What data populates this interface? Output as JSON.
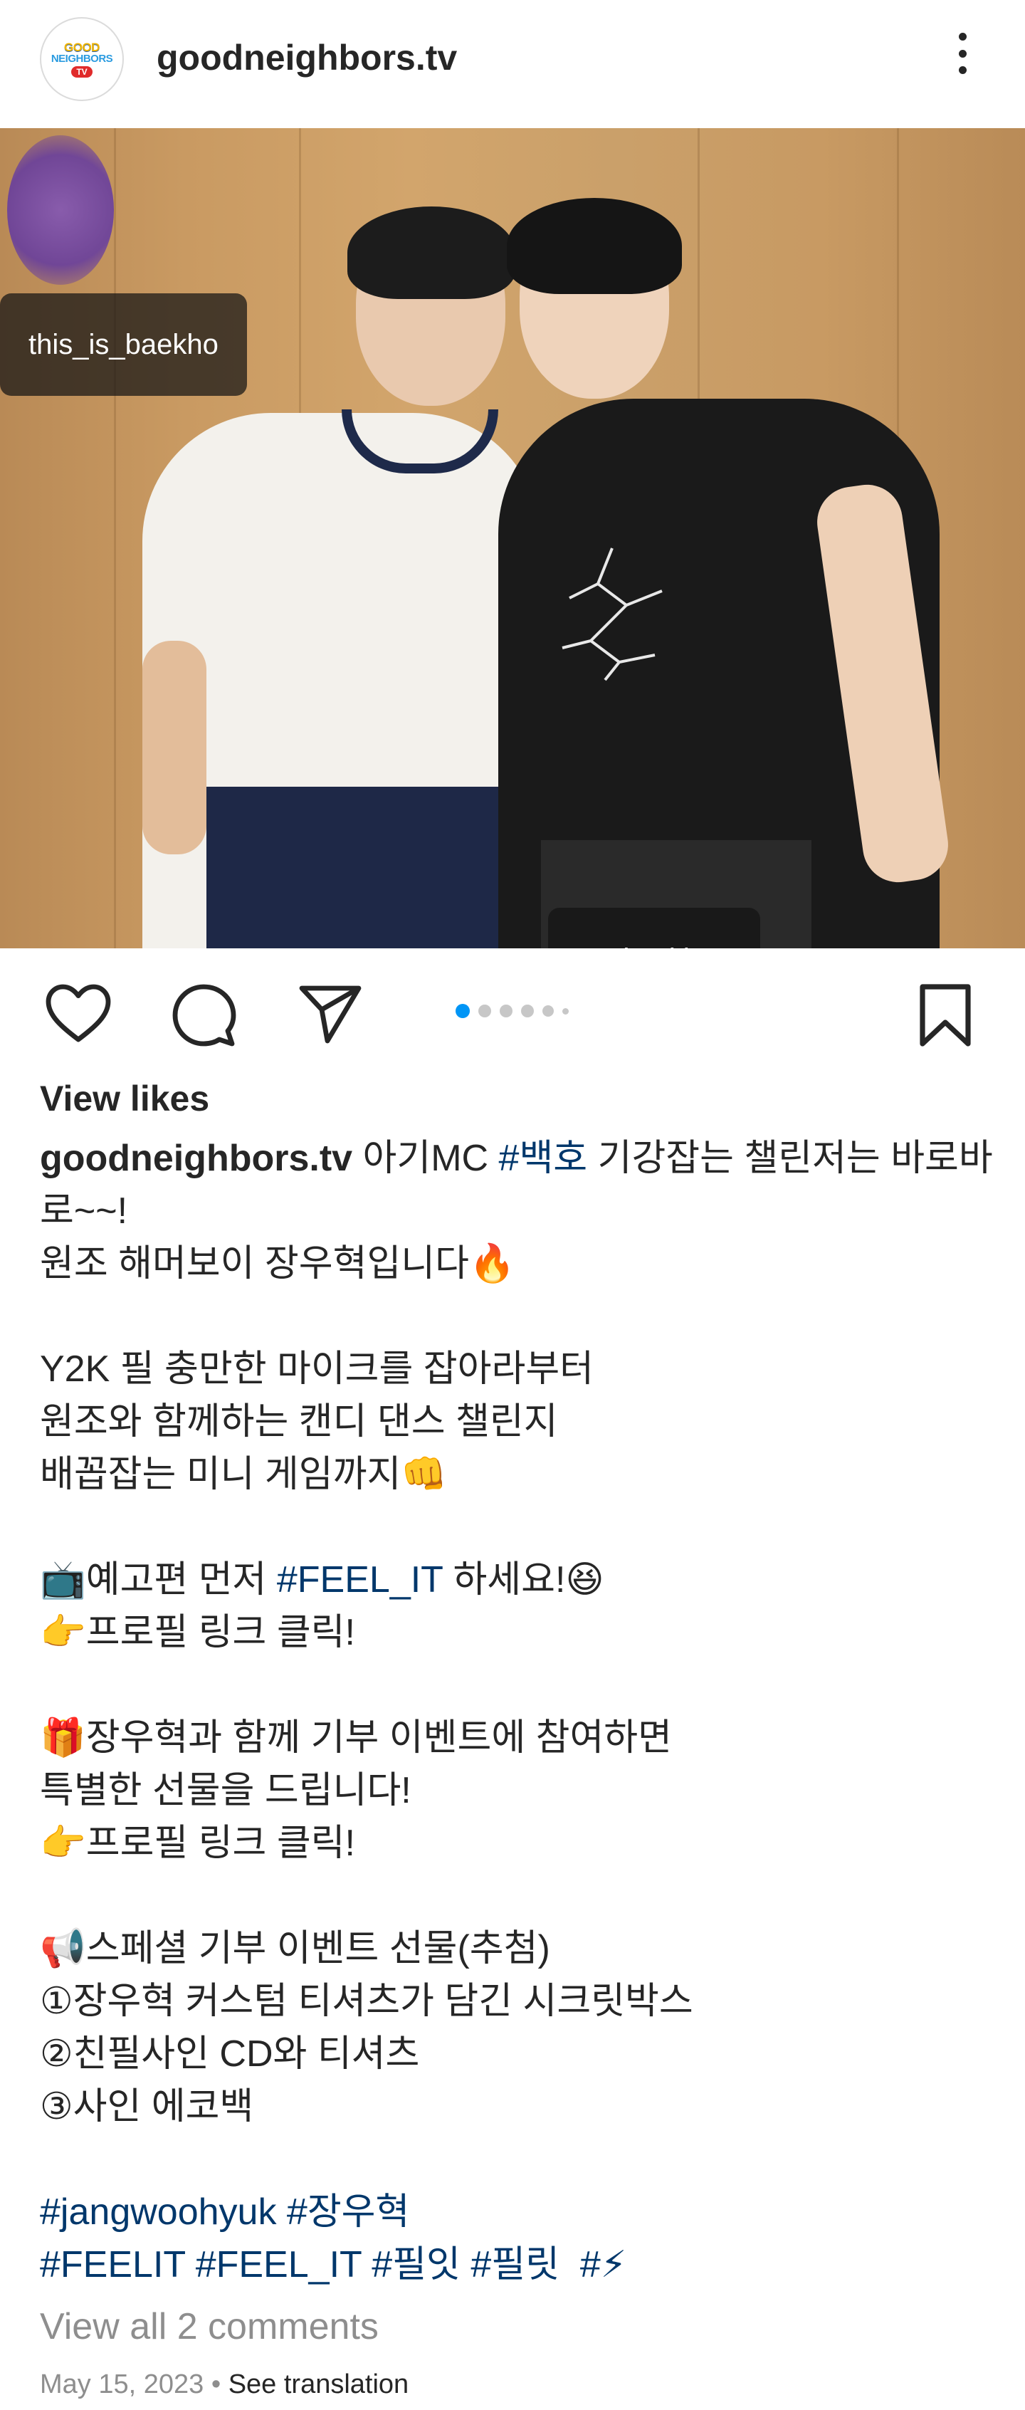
{
  "header": {
    "username": "goodneighbors.tv",
    "avatar_logo": {
      "line1": "GOOD",
      "line2": "NEIGHBORS",
      "tv": "TV"
    },
    "more_icon": "more-vertical-icon"
  },
  "photo": {
    "user_tags": [
      "this_is_baekho",
      "woohyukjang"
    ],
    "tags_icon": "user-tags-icon"
  },
  "actions": {
    "like_icon": "heart-icon",
    "comment_icon": "comment-icon",
    "share_icon": "send-icon",
    "save_icon": "bookmark-icon",
    "carousel": {
      "count": 6,
      "active_index": 0,
      "active_color": "#0095f6"
    }
  },
  "view_likes": "View likes",
  "caption": {
    "username": "goodneighbors.tv",
    "line1a": " 아기MC ",
    "hashtag_baekho": "#백호",
    "line1b": " 기강잡는 챌린저는 바로바로~~!",
    "line2": "원조 해머보이 장우혁입니다🔥",
    "line3": "Y2K 필 충만한 마이크를 잡아라부터",
    "line4": "원조와 함께하는 캔디 댄스 챌린지",
    "line5": "배꼽잡는 미니 게임까지👊",
    "line6a": "📺예고편 먼저 ",
    "hashtag_feel_it": "#FEEL_IT",
    "line6b": " 하세요!😆",
    "line7": "👉프로필 링크 클릭!",
    "line8": "🎁장우혁과 함께 기부 이벤트에 참여하면",
    "line9": "특별한 선물을 드립니다!",
    "line10": "👉프로필 링크 클릭!",
    "line11": "📢스페셜 기부 이벤트 선물(추첨)",
    "line12": "①장우혁 커스텀 티셔츠가 담긴 시크릿박스",
    "line13": "②친필사인 CD와 티셔츠",
    "line14": "③사인 에코백",
    "tags_line1": "#jangwoohyuk #장우혁",
    "tags_line2": "#FEELIT #FEEL_IT #필잇 #필릿  #⚡"
  },
  "view_comments": "View all 2 comments",
  "meta": {
    "date": "May 15, 2023",
    "separator": " • ",
    "see_translation": "See translation"
  }
}
